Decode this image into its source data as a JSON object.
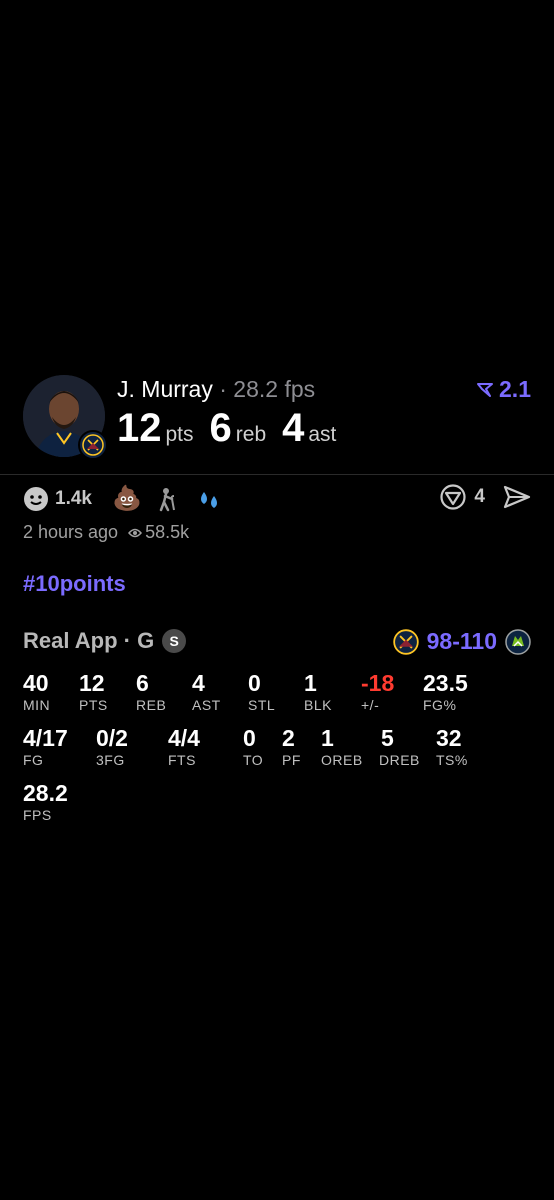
{
  "player": {
    "name": "J. Murray",
    "sep": "·",
    "fps": "28.2 fps",
    "badge_value": "2.1",
    "stats": [
      {
        "num": "12",
        "unit": "pts"
      },
      {
        "num": "6",
        "unit": "reb"
      },
      {
        "num": "4",
        "unit": "ast"
      }
    ]
  },
  "reactions": {
    "smile_count": "1.4k",
    "comment_count": "4",
    "time_ago": "2 hours ago",
    "views": "58.5k"
  },
  "hashtag": "#10points",
  "game": {
    "title": "Real App · G",
    "s_badge": "S",
    "score_home": "98",
    "score_sep": "-",
    "score_away": "110"
  },
  "boxscore": {
    "row1": [
      {
        "v": "40",
        "l": "MIN"
      },
      {
        "v": "12",
        "l": "PTS"
      },
      {
        "v": "6",
        "l": "REB"
      },
      {
        "v": "4",
        "l": "AST"
      },
      {
        "v": "0",
        "l": "STL"
      },
      {
        "v": "1",
        "l": "BLK"
      },
      {
        "v": "-18",
        "l": "+/-"
      },
      {
        "v": "23.5",
        "l": "FG%"
      }
    ],
    "row2": [
      {
        "v": "4/17",
        "l": "FG"
      },
      {
        "v": "0/2",
        "l": "3FG"
      },
      {
        "v": "4/4",
        "l": "FTS"
      },
      {
        "v": "0",
        "l": "TO"
      },
      {
        "v": "2",
        "l": "PF"
      },
      {
        "v": "1",
        "l": "OREB"
      },
      {
        "v": "5",
        "l": "DREB"
      },
      {
        "v": "32",
        "l": "TS%"
      }
    ],
    "row3": [
      {
        "v": "28.2",
        "l": "FPS"
      }
    ]
  },
  "colors": {
    "accent": "#7b6bff",
    "negative": "#ff3b30",
    "background": "#000000"
  }
}
